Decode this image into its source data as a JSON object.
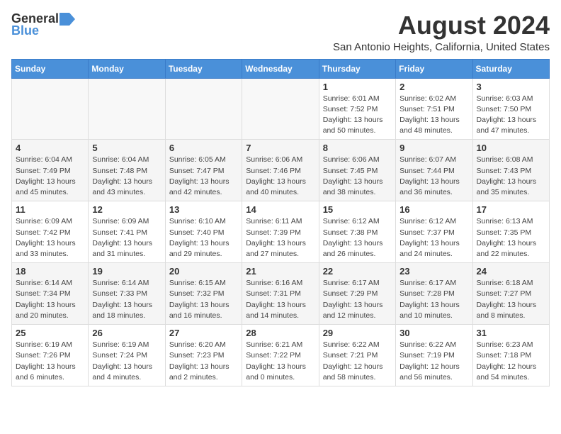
{
  "header": {
    "logo_general": "General",
    "logo_blue": "Blue",
    "month_year": "August 2024",
    "location": "San Antonio Heights, California, United States"
  },
  "calendar": {
    "days_of_week": [
      "Sunday",
      "Monday",
      "Tuesday",
      "Wednesday",
      "Thursday",
      "Friday",
      "Saturday"
    ],
    "weeks": [
      [
        {
          "day": "",
          "info": ""
        },
        {
          "day": "",
          "info": ""
        },
        {
          "day": "",
          "info": ""
        },
        {
          "day": "",
          "info": ""
        },
        {
          "day": "1",
          "info": "Sunrise: 6:01 AM\nSunset: 7:52 PM\nDaylight: 13 hours\nand 50 minutes."
        },
        {
          "day": "2",
          "info": "Sunrise: 6:02 AM\nSunset: 7:51 PM\nDaylight: 13 hours\nand 48 minutes."
        },
        {
          "day": "3",
          "info": "Sunrise: 6:03 AM\nSunset: 7:50 PM\nDaylight: 13 hours\nand 47 minutes."
        }
      ],
      [
        {
          "day": "4",
          "info": "Sunrise: 6:04 AM\nSunset: 7:49 PM\nDaylight: 13 hours\nand 45 minutes."
        },
        {
          "day": "5",
          "info": "Sunrise: 6:04 AM\nSunset: 7:48 PM\nDaylight: 13 hours\nand 43 minutes."
        },
        {
          "day": "6",
          "info": "Sunrise: 6:05 AM\nSunset: 7:47 PM\nDaylight: 13 hours\nand 42 minutes."
        },
        {
          "day": "7",
          "info": "Sunrise: 6:06 AM\nSunset: 7:46 PM\nDaylight: 13 hours\nand 40 minutes."
        },
        {
          "day": "8",
          "info": "Sunrise: 6:06 AM\nSunset: 7:45 PM\nDaylight: 13 hours\nand 38 minutes."
        },
        {
          "day": "9",
          "info": "Sunrise: 6:07 AM\nSunset: 7:44 PM\nDaylight: 13 hours\nand 36 minutes."
        },
        {
          "day": "10",
          "info": "Sunrise: 6:08 AM\nSunset: 7:43 PM\nDaylight: 13 hours\nand 35 minutes."
        }
      ],
      [
        {
          "day": "11",
          "info": "Sunrise: 6:09 AM\nSunset: 7:42 PM\nDaylight: 13 hours\nand 33 minutes."
        },
        {
          "day": "12",
          "info": "Sunrise: 6:09 AM\nSunset: 7:41 PM\nDaylight: 13 hours\nand 31 minutes."
        },
        {
          "day": "13",
          "info": "Sunrise: 6:10 AM\nSunset: 7:40 PM\nDaylight: 13 hours\nand 29 minutes."
        },
        {
          "day": "14",
          "info": "Sunrise: 6:11 AM\nSunset: 7:39 PM\nDaylight: 13 hours\nand 27 minutes."
        },
        {
          "day": "15",
          "info": "Sunrise: 6:12 AM\nSunset: 7:38 PM\nDaylight: 13 hours\nand 26 minutes."
        },
        {
          "day": "16",
          "info": "Sunrise: 6:12 AM\nSunset: 7:37 PM\nDaylight: 13 hours\nand 24 minutes."
        },
        {
          "day": "17",
          "info": "Sunrise: 6:13 AM\nSunset: 7:35 PM\nDaylight: 13 hours\nand 22 minutes."
        }
      ],
      [
        {
          "day": "18",
          "info": "Sunrise: 6:14 AM\nSunset: 7:34 PM\nDaylight: 13 hours\nand 20 minutes."
        },
        {
          "day": "19",
          "info": "Sunrise: 6:14 AM\nSunset: 7:33 PM\nDaylight: 13 hours\nand 18 minutes."
        },
        {
          "day": "20",
          "info": "Sunrise: 6:15 AM\nSunset: 7:32 PM\nDaylight: 13 hours\nand 16 minutes."
        },
        {
          "day": "21",
          "info": "Sunrise: 6:16 AM\nSunset: 7:31 PM\nDaylight: 13 hours\nand 14 minutes."
        },
        {
          "day": "22",
          "info": "Sunrise: 6:17 AM\nSunset: 7:29 PM\nDaylight: 13 hours\nand 12 minutes."
        },
        {
          "day": "23",
          "info": "Sunrise: 6:17 AM\nSunset: 7:28 PM\nDaylight: 13 hours\nand 10 minutes."
        },
        {
          "day": "24",
          "info": "Sunrise: 6:18 AM\nSunset: 7:27 PM\nDaylight: 13 hours\nand 8 minutes."
        }
      ],
      [
        {
          "day": "25",
          "info": "Sunrise: 6:19 AM\nSunset: 7:26 PM\nDaylight: 13 hours\nand 6 minutes."
        },
        {
          "day": "26",
          "info": "Sunrise: 6:19 AM\nSunset: 7:24 PM\nDaylight: 13 hours\nand 4 minutes."
        },
        {
          "day": "27",
          "info": "Sunrise: 6:20 AM\nSunset: 7:23 PM\nDaylight: 13 hours\nand 2 minutes."
        },
        {
          "day": "28",
          "info": "Sunrise: 6:21 AM\nSunset: 7:22 PM\nDaylight: 13 hours\nand 0 minutes."
        },
        {
          "day": "29",
          "info": "Sunrise: 6:22 AM\nSunset: 7:21 PM\nDaylight: 12 hours\nand 58 minutes."
        },
        {
          "day": "30",
          "info": "Sunrise: 6:22 AM\nSunset: 7:19 PM\nDaylight: 12 hours\nand 56 minutes."
        },
        {
          "day": "31",
          "info": "Sunrise: 6:23 AM\nSunset: 7:18 PM\nDaylight: 12 hours\nand 54 minutes."
        }
      ]
    ]
  }
}
